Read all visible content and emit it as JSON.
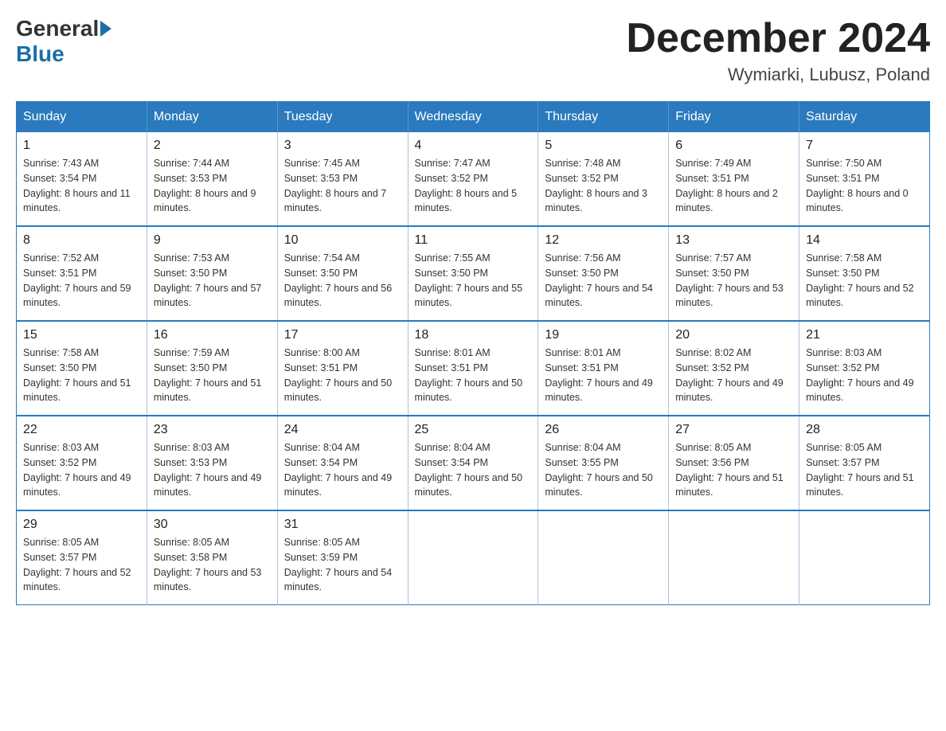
{
  "logo": {
    "general": "General",
    "blue": "Blue"
  },
  "title": "December 2024",
  "location": "Wymiarki, Lubusz, Poland",
  "days_of_week": [
    "Sunday",
    "Monday",
    "Tuesday",
    "Wednesday",
    "Thursday",
    "Friday",
    "Saturday"
  ],
  "weeks": [
    [
      {
        "day": "1",
        "sunrise": "7:43 AM",
        "sunset": "3:54 PM",
        "daylight": "8 hours and 11 minutes."
      },
      {
        "day": "2",
        "sunrise": "7:44 AM",
        "sunset": "3:53 PM",
        "daylight": "8 hours and 9 minutes."
      },
      {
        "day": "3",
        "sunrise": "7:45 AM",
        "sunset": "3:53 PM",
        "daylight": "8 hours and 7 minutes."
      },
      {
        "day": "4",
        "sunrise": "7:47 AM",
        "sunset": "3:52 PM",
        "daylight": "8 hours and 5 minutes."
      },
      {
        "day": "5",
        "sunrise": "7:48 AM",
        "sunset": "3:52 PM",
        "daylight": "8 hours and 3 minutes."
      },
      {
        "day": "6",
        "sunrise": "7:49 AM",
        "sunset": "3:51 PM",
        "daylight": "8 hours and 2 minutes."
      },
      {
        "day": "7",
        "sunrise": "7:50 AM",
        "sunset": "3:51 PM",
        "daylight": "8 hours and 0 minutes."
      }
    ],
    [
      {
        "day": "8",
        "sunrise": "7:52 AM",
        "sunset": "3:51 PM",
        "daylight": "7 hours and 59 minutes."
      },
      {
        "day": "9",
        "sunrise": "7:53 AM",
        "sunset": "3:50 PM",
        "daylight": "7 hours and 57 minutes."
      },
      {
        "day": "10",
        "sunrise": "7:54 AM",
        "sunset": "3:50 PM",
        "daylight": "7 hours and 56 minutes."
      },
      {
        "day": "11",
        "sunrise": "7:55 AM",
        "sunset": "3:50 PM",
        "daylight": "7 hours and 55 minutes."
      },
      {
        "day": "12",
        "sunrise": "7:56 AM",
        "sunset": "3:50 PM",
        "daylight": "7 hours and 54 minutes."
      },
      {
        "day": "13",
        "sunrise": "7:57 AM",
        "sunset": "3:50 PM",
        "daylight": "7 hours and 53 minutes."
      },
      {
        "day": "14",
        "sunrise": "7:58 AM",
        "sunset": "3:50 PM",
        "daylight": "7 hours and 52 minutes."
      }
    ],
    [
      {
        "day": "15",
        "sunrise": "7:58 AM",
        "sunset": "3:50 PM",
        "daylight": "7 hours and 51 minutes."
      },
      {
        "day": "16",
        "sunrise": "7:59 AM",
        "sunset": "3:50 PM",
        "daylight": "7 hours and 51 minutes."
      },
      {
        "day": "17",
        "sunrise": "8:00 AM",
        "sunset": "3:51 PM",
        "daylight": "7 hours and 50 minutes."
      },
      {
        "day": "18",
        "sunrise": "8:01 AM",
        "sunset": "3:51 PM",
        "daylight": "7 hours and 50 minutes."
      },
      {
        "day": "19",
        "sunrise": "8:01 AM",
        "sunset": "3:51 PM",
        "daylight": "7 hours and 49 minutes."
      },
      {
        "day": "20",
        "sunrise": "8:02 AM",
        "sunset": "3:52 PM",
        "daylight": "7 hours and 49 minutes."
      },
      {
        "day": "21",
        "sunrise": "8:03 AM",
        "sunset": "3:52 PM",
        "daylight": "7 hours and 49 minutes."
      }
    ],
    [
      {
        "day": "22",
        "sunrise": "8:03 AM",
        "sunset": "3:52 PM",
        "daylight": "7 hours and 49 minutes."
      },
      {
        "day": "23",
        "sunrise": "8:03 AM",
        "sunset": "3:53 PM",
        "daylight": "7 hours and 49 minutes."
      },
      {
        "day": "24",
        "sunrise": "8:04 AM",
        "sunset": "3:54 PM",
        "daylight": "7 hours and 49 minutes."
      },
      {
        "day": "25",
        "sunrise": "8:04 AM",
        "sunset": "3:54 PM",
        "daylight": "7 hours and 50 minutes."
      },
      {
        "day": "26",
        "sunrise": "8:04 AM",
        "sunset": "3:55 PM",
        "daylight": "7 hours and 50 minutes."
      },
      {
        "day": "27",
        "sunrise": "8:05 AM",
        "sunset": "3:56 PM",
        "daylight": "7 hours and 51 minutes."
      },
      {
        "day": "28",
        "sunrise": "8:05 AM",
        "sunset": "3:57 PM",
        "daylight": "7 hours and 51 minutes."
      }
    ],
    [
      {
        "day": "29",
        "sunrise": "8:05 AM",
        "sunset": "3:57 PM",
        "daylight": "7 hours and 52 minutes."
      },
      {
        "day": "30",
        "sunrise": "8:05 AM",
        "sunset": "3:58 PM",
        "daylight": "7 hours and 53 minutes."
      },
      {
        "day": "31",
        "sunrise": "8:05 AM",
        "sunset": "3:59 PM",
        "daylight": "7 hours and 54 minutes."
      },
      null,
      null,
      null,
      null
    ]
  ],
  "labels": {
    "sunrise": "Sunrise:",
    "sunset": "Sunset:",
    "daylight": "Daylight:"
  }
}
